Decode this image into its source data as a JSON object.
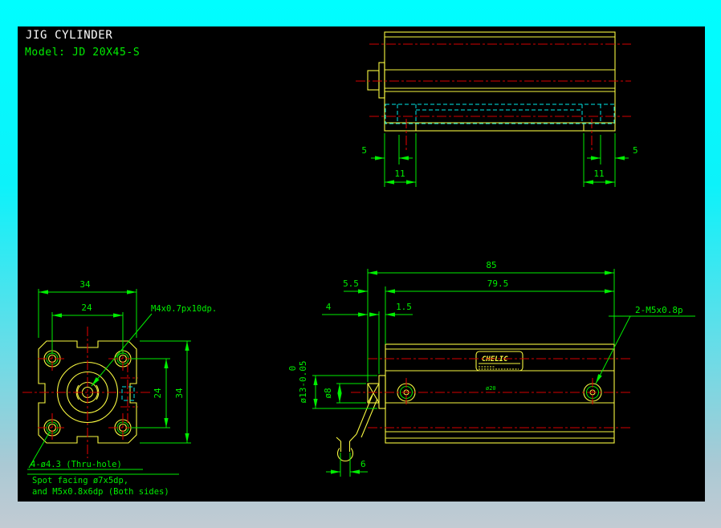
{
  "header": {
    "title": "JIG CYLINDER",
    "model": "Model:  JD 20X45-S"
  },
  "colors": {
    "background": "#000000",
    "frame_top": "#00feff",
    "frame_bottom": "#c2cbd3",
    "outline": "#f8f840",
    "dimension": "#00ee00",
    "centerline": "#d40000",
    "hidden_line": "#00e8e8",
    "title_text": "#ffffff"
  },
  "top_view": {
    "dims": {
      "left_offset": "5",
      "left_pitch": "11",
      "right_pitch": "11",
      "right_offset": "5"
    }
  },
  "front_view": {
    "dims": {
      "width_outer": "34",
      "width_bolt": "24",
      "height_bolt": "24",
      "height_outer": "34"
    },
    "notes": {
      "tap": "M4x0.7px10dp.",
      "thru_hole": "4-ø4.3 (Thru-hole)",
      "spot_facing_1": "Spot facing ø7x5dp,",
      "spot_facing_2": "and M5x0.8x6dp (Both sides)"
    }
  },
  "main_view": {
    "dims": {
      "overall_length": "85",
      "body_length": "79.5",
      "rod_extension": "5.5",
      "rod_tip": "4",
      "boss_height": "1.5",
      "boss_dia": "ø13-0.05",
      "boss_tol_upper": "0",
      "rod_dia": "ø8",
      "flats_width": "6"
    },
    "notes": {
      "ports": "2-M5x0.8p",
      "bore": "ø20"
    },
    "brand": {
      "name": "CHELIC"
    }
  }
}
